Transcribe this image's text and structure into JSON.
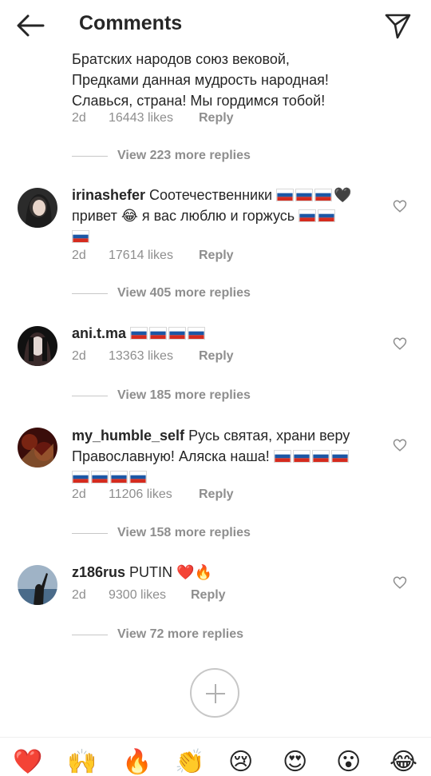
{
  "header": {
    "title": "Comments"
  },
  "top_comment": {
    "text_lines": "Братских народов союз вековой,\nПредками данная мудрость народная!\nСлавься, страна! Мы гордимся тобой!",
    "time": "2d",
    "likes": "16443 likes",
    "reply": "Reply",
    "view_replies": "View 223 more replies"
  },
  "comments": [
    {
      "username": "irinashefer",
      "text_a": " Соотечественники ",
      "text_b": "привет ",
      "emoji_laugh": "😂",
      "text_c": " я вас люблю и горжусь ",
      "emoji_heart_black": "🖤",
      "time": "2d",
      "likes": "17614 likes",
      "reply": "Reply",
      "view_replies": "View 405 more replies"
    },
    {
      "username": "ani.t.ma",
      "time": "2d",
      "likes": "13363 likes",
      "reply": "Reply",
      "view_replies": "View 185 more replies"
    },
    {
      "username": "my_humble_self",
      "text_a": " Русь святая, храни веру Православную! Аляска наша! ",
      "time": "2d",
      "likes": "11206 likes",
      "reply": "Reply",
      "view_replies": "View 158 more replies"
    },
    {
      "username": "z186rus",
      "text_a": " PUTIN ",
      "emoji_heart": "❤️",
      "emoji_fire": "🔥",
      "time": "2d",
      "likes": "9300 likes",
      "reply": "Reply",
      "view_replies": "View 72 more replies"
    }
  ],
  "emoji_bar": [
    "❤️",
    "🙌",
    "🔥",
    "👏",
    "😢",
    "😍",
    "😮",
    "😂"
  ],
  "icons": {
    "back": "arrow-left-icon",
    "send": "paper-plane-icon",
    "like": "heart-outline-icon",
    "add": "plus-icon"
  },
  "colors": {
    "text": "#262626",
    "secondary": "#8e8e8e",
    "divider": "#c7c7c7",
    "flag_white": "#ffffff",
    "flag_blue": "#1c57a5",
    "flag_red": "#d52b1e"
  }
}
